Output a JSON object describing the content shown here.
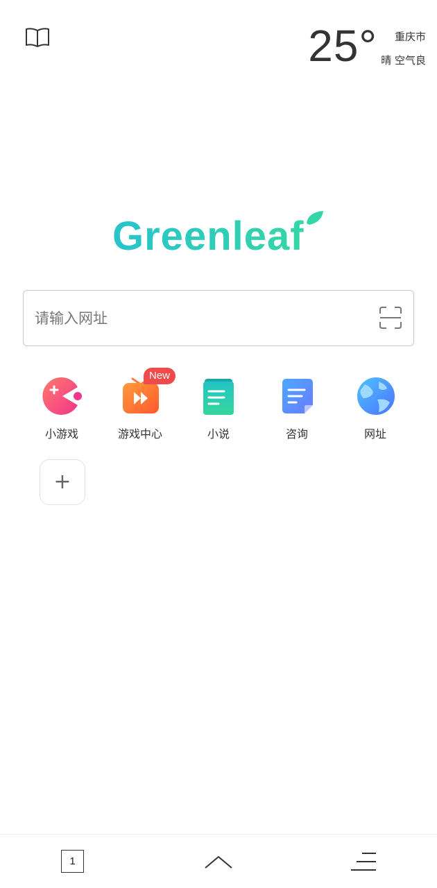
{
  "header": {
    "book_icon": "open-book-icon",
    "weather": {
      "temperature": "25°",
      "city": "重庆市",
      "condition": "晴 空气良"
    }
  },
  "logo": {
    "text": "Greenleaf",
    "colors": [
      "#2ac6c6",
      "#33d6a8"
    ]
  },
  "search": {
    "placeholder": "请输入网址",
    "value": "",
    "scan_icon": "scan-frame-icon"
  },
  "shortcuts": {
    "items": [
      {
        "label": "小游戏",
        "icon": "pacman-game-icon"
      },
      {
        "label": "游戏中心",
        "icon": "fast-forward-icon",
        "badge": "New"
      },
      {
        "label": "小说",
        "icon": "novel-book-icon"
      },
      {
        "label": "咨询",
        "icon": "news-doc-icon"
      },
      {
        "label": "网址",
        "icon": "globe-icon"
      }
    ],
    "add_label": "+"
  },
  "bottom_bar": {
    "tab_count": "1",
    "up_icon": "chevron-up-icon",
    "menu_icon": "menu-lines-icon"
  },
  "colors": {
    "badge": "#f04b4b",
    "border": "#c9c9c9",
    "text": "#333333"
  }
}
